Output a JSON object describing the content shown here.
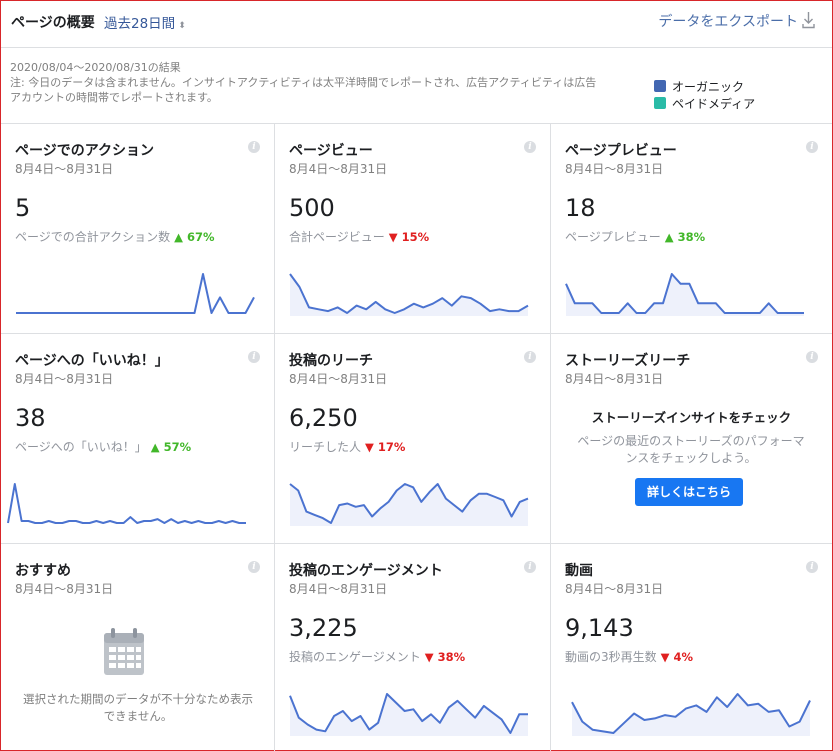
{
  "header": {
    "title": "ページの概要",
    "period": "過去28日間",
    "export": "データをエクスポート"
  },
  "notes": {
    "range": "2020/08/04～2020/08/31の結果",
    "line1": "注: 今日のデータは含まれません。インサイトアクティビティは太平洋時間でレポートされ、広告アクティビティは広告",
    "line2": "アカウントの時間帯でレポートされます。"
  },
  "legend": [
    {
      "label": "オーガニック",
      "color": "#4267b2"
    },
    {
      "label": "ペイドメディア",
      "color": "#2abba7"
    }
  ],
  "colors": {
    "line": "#4b73d0",
    "fill": "#eef1fb",
    "up": "#42b72a",
    "down": "#e02020"
  },
  "cards": {
    "actions": {
      "title": "ページでのアクション",
      "date": "8月4日～8月31日",
      "value": "5",
      "label": "ページでの合計アクション数",
      "change": "▲ 67%",
      "direction": "up",
      "series": [
        0,
        0,
        0,
        0,
        0,
        0,
        0,
        0,
        0,
        0,
        0,
        0,
        0,
        0,
        0,
        0,
        0,
        0,
        0,
        0,
        0,
        0,
        1,
        0,
        0.4,
        0,
        0,
        0,
        0.4
      ]
    },
    "page_views": {
      "title": "ページビュー",
      "date": "8月4日～8月31日",
      "value": "500",
      "label": "合計ページビュー",
      "change": "▼ 15%",
      "direction": "down",
      "series": [
        26,
        19,
        8,
        7,
        6,
        8,
        5,
        9,
        7,
        11,
        7,
        5,
        7,
        10,
        8,
        10,
        13,
        9,
        14,
        13,
        10,
        6,
        7,
        6,
        6,
        9
      ]
    },
    "page_previews": {
      "title": "ページプレビュー",
      "date": "8月4日～8月31日",
      "value": "18",
      "label": "ページプレビュー",
      "change": "▲ 38%",
      "direction": "up",
      "series": [
        3,
        1,
        1,
        1,
        0,
        0,
        0,
        1,
        0,
        0,
        1,
        1,
        4,
        3,
        3,
        1,
        1,
        1,
        0,
        0,
        0,
        0,
        0,
        1,
        0,
        0,
        0,
        0
      ]
    },
    "likes": {
      "title": "ページへの「いいね！」",
      "date": "8月4日～8月31日",
      "value": "38",
      "label": "ページへの「いいね！」",
      "change": "▲ 57%",
      "direction": "up",
      "series": [
        0,
        20,
        1,
        1,
        0,
        0,
        1,
        0,
        0,
        1,
        1,
        0,
        0,
        1,
        0,
        1,
        0,
        0,
        3,
        0,
        1,
        1,
        2,
        0,
        2,
        0,
        1,
        0,
        1,
        0,
        0,
        1,
        0,
        1,
        0,
        0
      ]
    },
    "reach": {
      "title": "投稿のリーチ",
      "date": "8月4日～8月31日",
      "value": "6,250",
      "label": "リーチした人",
      "change": "▼ 17%",
      "direction": "down",
      "series": [
        30,
        26,
        13,
        11,
        9,
        6,
        17,
        18,
        16,
        17,
        10,
        15,
        19,
        26,
        30,
        28,
        19,
        25,
        30,
        21,
        17,
        13,
        20,
        24,
        24,
        22,
        20,
        10,
        19,
        21
      ]
    },
    "stories": {
      "title": "ストーリーズリーチ",
      "date": "8月4日～8月31日",
      "cta_title": "ストーリーズインサイトをチェック",
      "cta_text": "ページの最近のストーリーズのパフォーマンスをチェックしよう。",
      "cta_button": "詳しくはこちら"
    },
    "recommendations": {
      "title": "おすすめ",
      "date": "8月4日～8月31日",
      "empty": "選択された期間のデータが不十分なため表示できません。"
    },
    "engagement": {
      "title": "投稿のエンゲージメント",
      "date": "8月4日～8月31日",
      "value": "3,225",
      "label": "投稿のエンゲージメント",
      "change": "▼ 38%",
      "direction": "down",
      "series": [
        25,
        12,
        8,
        5,
        4,
        13,
        16,
        10,
        13,
        5,
        9,
        26,
        21,
        16,
        17,
        10,
        14,
        9,
        18,
        22,
        17,
        12,
        19,
        15,
        11,
        3,
        14,
        14
      ]
    },
    "video": {
      "title": "動画",
      "date": "8月4日～8月31日",
      "value": "9,143",
      "label": "動画の3秒再生数",
      "change": "▼ 4%",
      "direction": "down",
      "series": [
        22,
        10,
        5,
        4,
        3,
        9,
        15,
        11,
        12,
        14,
        13,
        18,
        20,
        16,
        25,
        19,
        27,
        20,
        21,
        16,
        17,
        7,
        10,
        23
      ]
    }
  }
}
